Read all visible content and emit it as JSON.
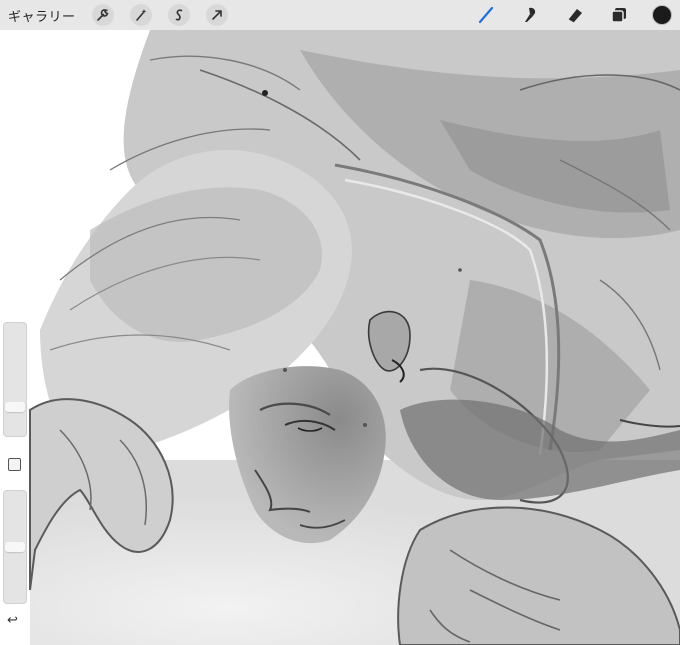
{
  "toolbar": {
    "gallery_label": "ギャラリー",
    "left_tools": [
      {
        "icon": "wrench-icon"
      },
      {
        "icon": "magic-wand-icon"
      },
      {
        "icon": "selection-icon"
      },
      {
        "icon": "transform-arrow-icon"
      }
    ],
    "right_tools": [
      {
        "icon": "brush-icon",
        "active": true
      },
      {
        "icon": "smudge-icon"
      },
      {
        "icon": "eraser-icon"
      },
      {
        "icon": "layers-icon"
      }
    ],
    "current_color": "#1a1a1a",
    "accent_color": "#1e6fe0"
  },
  "sidebar": {
    "brush_size_level": 0.3,
    "opacity_level": 0.5,
    "undo_icon": "↩"
  }
}
